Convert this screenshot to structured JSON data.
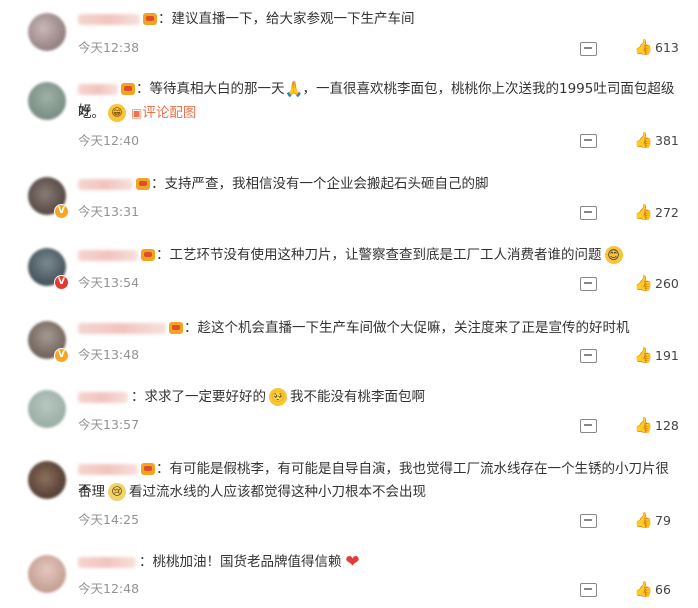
{
  "comments": [
    {
      "text": "建议直播一下，给大家参观一下生产车间",
      "time": "今天12:38",
      "likes": "613"
    },
    {
      "text_a": "等待真相大白的那一天",
      "text_b": "，一直很喜欢桃李面包，桃桃你上次送我的1995吐司面包超级好",
      "text_c": "吃。",
      "link": "评论配图",
      "time": "今天12:40",
      "likes": "381"
    },
    {
      "text": "支持严查，我相信没有一个企业会搬起石头砸自己的脚",
      "time": "今天13:31",
      "likes": "272"
    },
    {
      "text": "工艺环节没有使用这种刀片，让警察查查到底是工厂工人消费者谁的问题",
      "time": "今天13:54",
      "likes": "260"
    },
    {
      "text": "趁这个机会直播一下生产车间做个大促嘛，关注度来了正是宣传的好时机",
      "time": "今天13:48",
      "likes": "191"
    },
    {
      "text_a": "求求了一定要好好的",
      "text_b": "我不能没有桃李面包啊",
      "time": "今天13:57",
      "likes": "128"
    },
    {
      "text_a": "有可能是假桃李，有可能是自导自演，我也觉得工厂流水线存在一个生锈的小刀片很不",
      "text_b": "合理",
      "text_c": "看过流水线的人应该都觉得这种小刀根本不会出现",
      "time": "今天14:25",
      "likes": "79"
    },
    {
      "text": "桃桃加油！国货老品牌值得信赖",
      "time": "今天12:48",
      "likes": "66"
    }
  ],
  "icons": {
    "reply": "comment-icon",
    "like": "thumbs-up-icon",
    "image": "image-icon"
  },
  "colors": {
    "link": "#eb7350",
    "time": "#939393",
    "verified_gold": "#f5a623",
    "verified_red": "#e6392b"
  }
}
